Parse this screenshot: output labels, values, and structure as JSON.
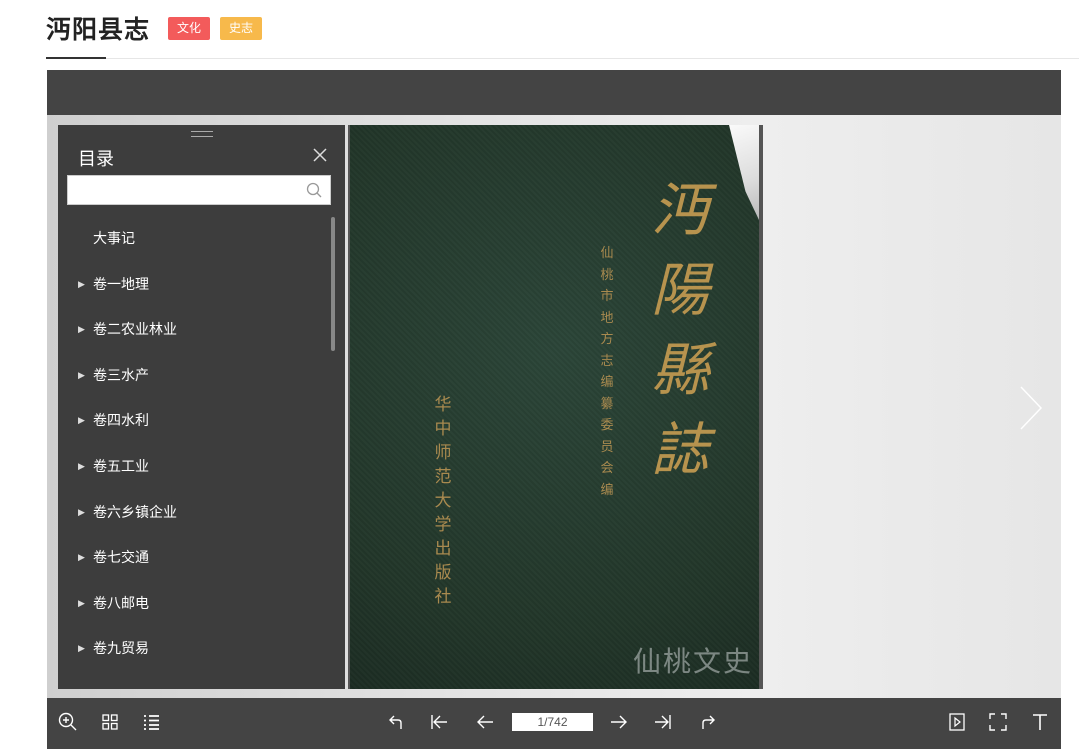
{
  "header": {
    "title": "沔阳县志",
    "tags": [
      "文化",
      "史志"
    ]
  },
  "toc": {
    "title": "目录",
    "search_placeholder": "",
    "items": [
      {
        "label": "大事记",
        "has_children": false
      },
      {
        "label": "卷一地理",
        "has_children": true
      },
      {
        "label": "卷二农业林业",
        "has_children": true
      },
      {
        "label": "卷三水产",
        "has_children": true
      },
      {
        "label": "卷四水利",
        "has_children": true
      },
      {
        "label": "卷五工业",
        "has_children": true
      },
      {
        "label": "卷六乡镇企业",
        "has_children": true
      },
      {
        "label": "卷七交通",
        "has_children": true
      },
      {
        "label": "卷八邮电",
        "has_children": true
      },
      {
        "label": "卷九贸易",
        "has_children": true
      }
    ]
  },
  "book": {
    "cover_title": "沔陽縣誌",
    "compiler": "仙桃市地方志编纂委员会编",
    "publisher": "华中师范大学出版社",
    "watermark": "仙桃文史",
    "cover_color": "#263b31",
    "text_color": "#b7934e"
  },
  "toolbar": {
    "page_indicator": "1/742",
    "icons_left": [
      "zoom-in-icon",
      "thumbnails-icon",
      "toc-list-icon"
    ],
    "icons_center": [
      "undo-icon",
      "first-page-icon",
      "prev-page-icon",
      "next-page-icon",
      "last-page-icon",
      "redo-icon"
    ],
    "icons_right": [
      "autoplay-icon",
      "fullscreen-icon",
      "text-icon"
    ]
  },
  "colors": {
    "tag_culture": "#f35b5b",
    "tag_history": "#f7b94b",
    "toolbar_bg": "#444444",
    "toc_bg": "#3d3d3d"
  }
}
